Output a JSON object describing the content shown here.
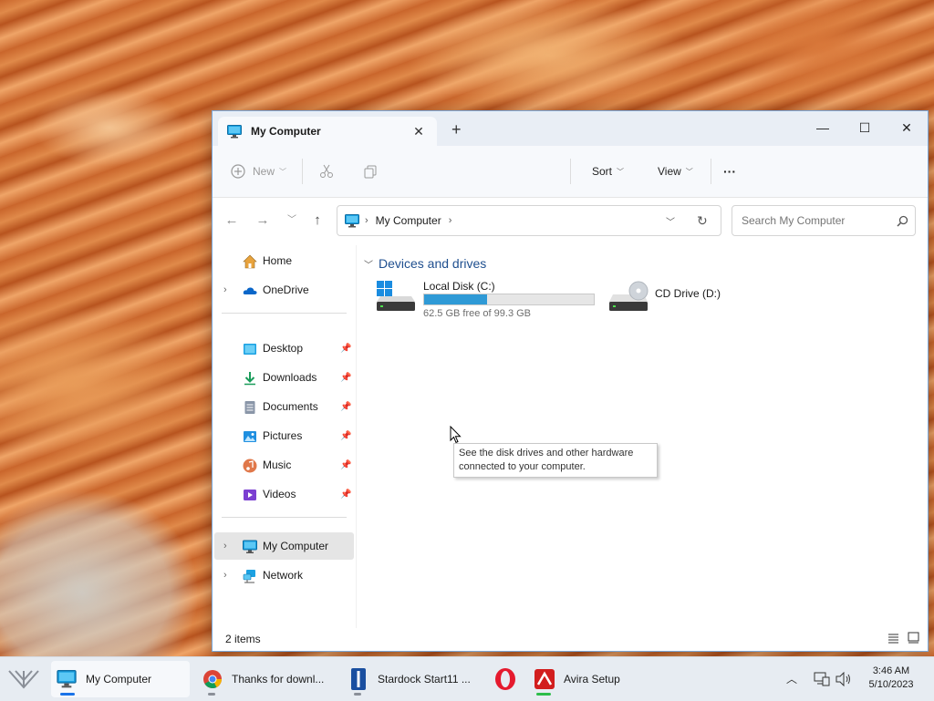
{
  "window": {
    "tab_title": "My Computer",
    "tab_close": "✕",
    "new_tab": "+",
    "minimize": "—",
    "maximize": "☐",
    "close": "✕"
  },
  "toolbar": {
    "new_label": "New",
    "sort_label": "Sort",
    "view_label": "View",
    "more_label": "···"
  },
  "address": {
    "crumb": "My Computer",
    "search_placeholder": "Search My Computer"
  },
  "sidebar": {
    "items": [
      {
        "label": "Home"
      },
      {
        "label": "OneDrive"
      },
      {
        "label": "Desktop"
      },
      {
        "label": "Downloads"
      },
      {
        "label": "Documents"
      },
      {
        "label": "Pictures"
      },
      {
        "label": "Music"
      },
      {
        "label": "Videos"
      },
      {
        "label": "My Computer"
      },
      {
        "label": "Network"
      }
    ]
  },
  "content": {
    "group_title": "Devices and drives",
    "drives": [
      {
        "name": "Local Disk (C:)",
        "free": "62.5 GB free of 99.3 GB",
        "used_fraction": 0.37
      },
      {
        "name": "CD Drive (D:)"
      }
    ],
    "tooltip_line1": "See the disk drives and other hardware",
    "tooltip_line2": "connected to your computer."
  },
  "status": {
    "item_count": "2 items"
  },
  "taskbar": {
    "items": [
      {
        "label": "My Computer"
      },
      {
        "label": "Thanks for downl..."
      },
      {
        "label": "Stardock Start11 ..."
      },
      {
        "label": ""
      },
      {
        "label": "Avira Setup"
      }
    ],
    "time": "3:46 AM",
    "date": "5/10/2023"
  },
  "colors": {
    "accent": "#2f9ad6",
    "group_header": "#1f4f8f",
    "selection": "#e5e5e5"
  }
}
